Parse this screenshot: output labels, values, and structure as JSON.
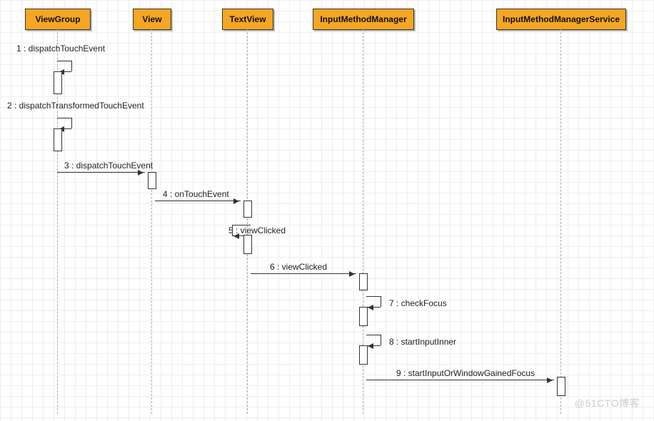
{
  "participants": {
    "viewGroup": "ViewGroup",
    "view": "View",
    "textView": "TextView",
    "imm": "InputMethodManager",
    "imms": "InputMethodManagerService"
  },
  "messages": {
    "m1": "1 : dispatchTouchEvent",
    "m2": "2 : dispatchTransformedTouchEvent",
    "m3": "3 : dispatchTouchEvent",
    "m4": "4 : onTouchEvent",
    "m5": "5 : viewClicked",
    "m6": "6 : viewClicked",
    "m7": "7 : checkFocus",
    "m8": "8 : startInputInner",
    "m9": "9 : startInputOrWindowGainedFocus"
  },
  "watermark": "@51CTO博客"
}
